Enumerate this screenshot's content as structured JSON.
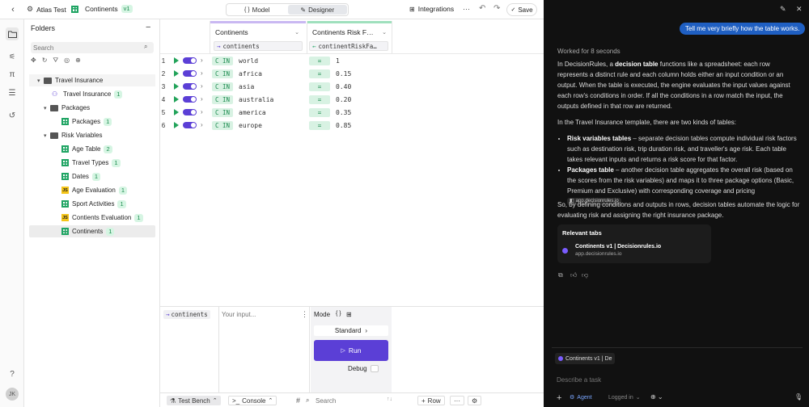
{
  "header": {
    "project": "Atlas Test",
    "table_name": "Continents",
    "version": "v1",
    "modes": [
      {
        "label": "Model"
      },
      {
        "label": "Designer"
      }
    ],
    "integrations": "Integrations",
    "save": "Save",
    "more": "···"
  },
  "folders": {
    "title": "Folders",
    "search_placeholder": "Search",
    "items": [
      {
        "label": "Travel Insurance",
        "type": "folder",
        "count": ""
      },
      {
        "label": "Travel Insurance",
        "type": "flow",
        "count": "1"
      },
      {
        "label": "Packages",
        "type": "folder",
        "count": ""
      },
      {
        "label": "Packages",
        "type": "table",
        "count": "1"
      },
      {
        "label": "Risk Variables",
        "type": "folder",
        "count": ""
      },
      {
        "label": "Age Table",
        "type": "table",
        "count": "2"
      },
      {
        "label": "Travel Types",
        "type": "table",
        "count": "1"
      },
      {
        "label": "Dates",
        "type": "table",
        "count": "1"
      },
      {
        "label": "Age Evaluation",
        "type": "js",
        "count": "1"
      },
      {
        "label": "Sport Activities",
        "type": "table",
        "count": "1"
      },
      {
        "label": "Contients Evaluation",
        "type": "js",
        "count": "1"
      },
      {
        "label": "Continents",
        "type": "table",
        "count": "1"
      }
    ]
  },
  "table": {
    "columns": [
      {
        "header": "Continents",
        "sub": "continents",
        "sub_icon": "→"
      },
      {
        "header": "Continents Risk F…",
        "sub": "continentRiskFa…",
        "sub_icon": "←"
      }
    ],
    "rows": [
      {
        "num": "1",
        "op": "C IN",
        "cond": "world",
        "op2": "=",
        "out": "1"
      },
      {
        "num": "2",
        "op": "C IN",
        "cond": "africa",
        "op2": "=",
        "out": "0.15"
      },
      {
        "num": "3",
        "op": "C IN",
        "cond": "asia",
        "op2": "=",
        "out": "0.40"
      },
      {
        "num": "4",
        "op": "C IN",
        "cond": "australia",
        "op2": "=",
        "out": "0.20"
      },
      {
        "num": "5",
        "op": "C IN",
        "cond": "america",
        "op2": "=",
        "out": "0.35"
      },
      {
        "num": "6",
        "op": "C IN",
        "cond": "europe",
        "op2": "=",
        "out": "0.85"
      }
    ]
  },
  "bench": {
    "input_chip": "continents",
    "input_placeholder": "Your input...",
    "mode_label": "Mode",
    "standard": "Standard",
    "run": "Run",
    "debug": "Debug"
  },
  "bottombar": {
    "test_bench": "Test Bench",
    "console": "Console",
    "search_placeholder": "Search",
    "row": "Row"
  },
  "chat": {
    "user_message": "Tell me very briefly how the table works.",
    "worked": "Worked for 8 seconds",
    "p1_a": "In DecisionRules, a ",
    "p1_b": "decision table",
    "p1_c": " functions like a spreadsheet: each row represents a distinct rule and each column holds either an input condition or an output. When the table is executed, the engine evaluates the input values against each row's conditions in order. If all the conditions in a row match the input, the outputs defined in that row are returned.",
    "p2": "In the Travel Insurance template, there are two kinds of tables:",
    "li1_b": "Risk variables tables",
    "li1": " – separate decision tables compute individual risk factors such as destination risk, trip duration risk, and traveller's age risk. Each table takes relevant inputs and returns a risk score for that factor.",
    "li2_b": "Packages table",
    "li2": " – another decision table aggregates the overall risk (based on the scores from the risk variables) and maps it to three package options (Basic, Premium and Exclusive) with corresponding coverage and pricing",
    "li2_pill": "app.decisionrules.io",
    "p3": "So, by defining conditions and outputs in rows, decision tables automate the logic for evaluating risk and assigning the right insurance package.",
    "relevant_title": "Relevant tabs",
    "relevant_item_title": "Continents v1 | Decisionrules.io",
    "relevant_item_url": "app.decisionrules.io",
    "context_chip": "Continents v1 | De",
    "composer_placeholder": "Describe a task",
    "agent": "Agent",
    "logged_in": "Logged in"
  },
  "colors": {
    "accent": "#5b3fd6",
    "green": "#1fa463",
    "chat_bg": "#111111",
    "user_bubble": "#1f5fc2"
  }
}
